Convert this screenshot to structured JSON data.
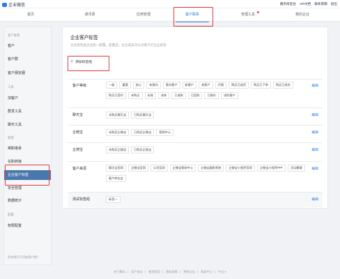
{
  "header": {
    "logo_text": "企业微信",
    "links": [
      "服务商后台",
      "API文档",
      "联系客服",
      "退出"
    ]
  },
  "nav": {
    "tabs": [
      {
        "label": "首页"
      },
      {
        "label": "通讯录"
      },
      {
        "label": "应用管理"
      },
      {
        "label": "客户联系",
        "active": true
      },
      {
        "label": "管理工具",
        "badge": true
      },
      {
        "label": "我的企业"
      }
    ]
  },
  "sidebar": {
    "groups": [
      {
        "label": "客户联系",
        "items": [
          "客户",
          "客户群",
          "客户朋友圈"
        ]
      },
      {
        "label": "工具",
        "items": [
          "加客户",
          "群发工具",
          "聊天工具"
        ]
      },
      {
        "label": "管理",
        "items": [
          "离职继承",
          "在职转接",
          "企业客户标签",
          "安全管理",
          "数据统计"
        ]
      },
      {
        "label": "配置",
        "items": [
          "权限配置"
        ]
      }
    ],
    "active_item": "企业客户标签",
    "footer": "如何提升可添加客户数？"
  },
  "main": {
    "title": "企业客户标签",
    "description": "企业标签由企业统一配置，配置后，企业成员可以对客户打企业标签",
    "add_button": "添加标签组",
    "edit_label": "编辑",
    "groups": [
      {
        "name": "客户等级",
        "tags": [
          "一般",
          "重要",
          "核心",
          "有意向",
          "意向客户",
          "新客户",
          "老客户",
          "代理",
          "购买已退货",
          "购买已下单",
          "购买已成交",
          "购买已签约",
          "未购买",
          "无效",
          "流失",
          "已退款",
          "已回款",
          "已报价",
          "进阶客户"
        ]
      },
      {
        "name": "聊天宝",
        "tags": [
          "未购买聊天宝",
          "已购买聊天宝"
        ]
      },
      {
        "name": "企微宝",
        "tags": [
          "未购买企微宝",
          "已购买企微宝",
          "营销中心"
        ]
      },
      {
        "name": "企搜宝",
        "tags": [
          "未购买企搜宝",
          "已购买企搜宝"
        ]
      },
      {
        "name": "客户来源",
        "tags": [
          "聊天宝官网",
          "企微宝官网",
          "公司官网",
          "企微宝帮助中心",
          "企微宝跟踪系统",
          "企微宝小程序官网",
          "企微宝小程序PPT",
          "活动聚客",
          "客户转化宝"
        ]
      },
      {
        "name": "测试标签组",
        "tags": [
          "标签一"
        ]
      }
    ]
  },
  "footer": {
    "links": [
      "关于腾讯",
      "用户协议",
      "使用规范",
      "隐私政策",
      "更新日志",
      "帮助中心",
      "中文 ▾"
    ]
  }
}
